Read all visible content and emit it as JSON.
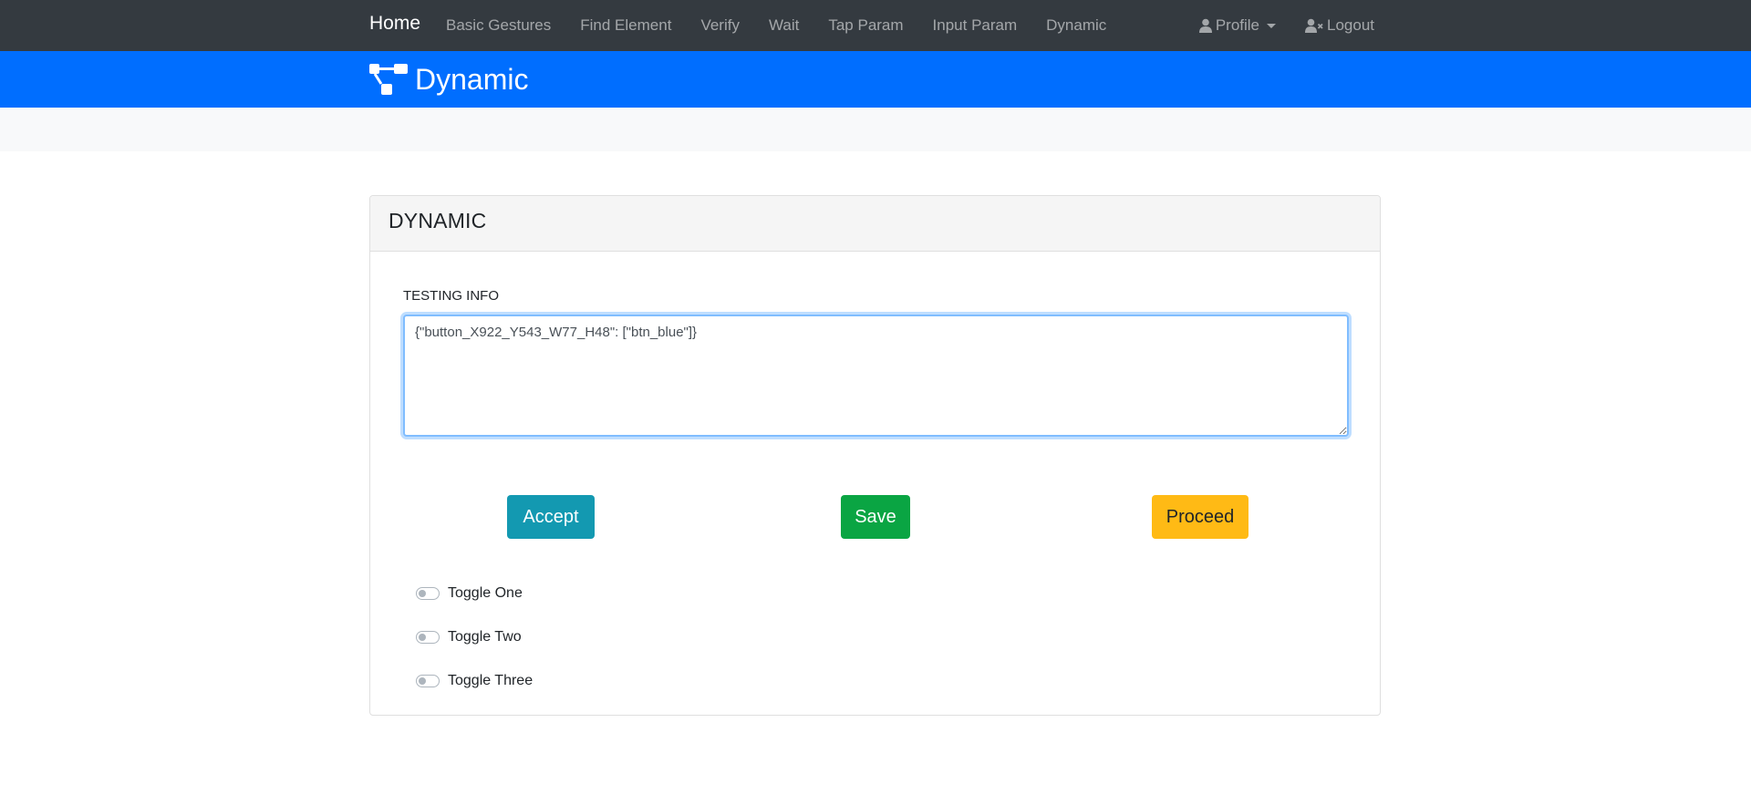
{
  "navbar": {
    "brand": "Home",
    "links": [
      "Basic Gestures",
      "Find Element",
      "Verify",
      "Wait",
      "Tap Param",
      "Input Param",
      "Dynamic"
    ],
    "profile_label": "Profile",
    "logout_label": "Logout"
  },
  "header": {
    "title": "Dynamic",
    "icon": "sitemap-icon"
  },
  "card": {
    "title": "DYNAMIC",
    "testing_info_label": "TESTING INFO",
    "testing_info_value": "{\"button_X922_Y543_W77_H48\": [\"btn_blue\"]}",
    "buttons": {
      "accept": "Accept",
      "save": "Save",
      "proceed": "Proceed"
    },
    "toggles": [
      "Toggle One",
      "Toggle Two",
      "Toggle Three"
    ]
  },
  "colors": {
    "navbar": "#343a40",
    "header": "#006eff",
    "accept": "#1399b1",
    "save": "#0aa543",
    "proceed": "#ffba15"
  }
}
